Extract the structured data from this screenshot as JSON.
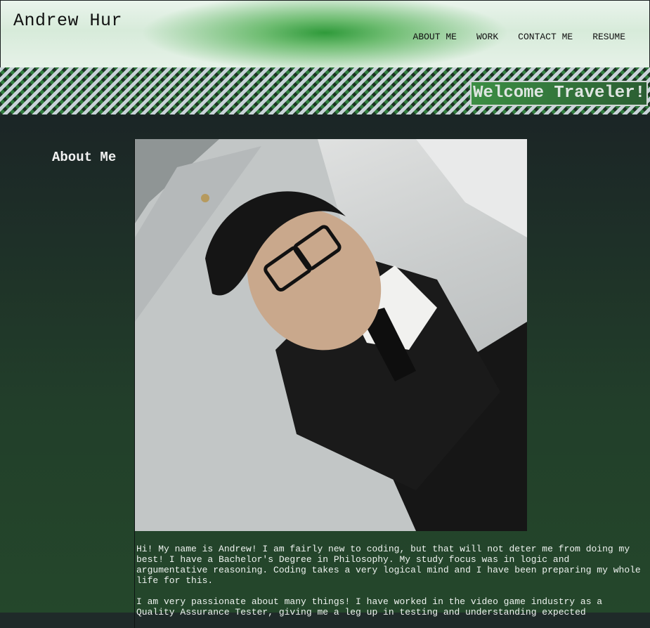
{
  "header": {
    "title": "Andrew Hur",
    "nav": [
      {
        "label": "ABOUT ME"
      },
      {
        "label": "WORK"
      },
      {
        "label": "CONTACT ME"
      },
      {
        "label": "RESUME"
      }
    ]
  },
  "banner": {
    "welcome_text": "Welcome Traveler!"
  },
  "about": {
    "heading": "About Me",
    "photo_icon": "profile-photo",
    "paragraphs": [
      "Hi! My name is Andrew! I am fairly new to coding, but that will not deter me from doing my best! I have a Bachelor's Degree in Philosophy. My study focus was in logic and argumentative reasoning. Coding takes a very logical mind and I have been preparing my whole life for this.",
      "I am very passionate about many things! I have worked in the video game industry as a Quality Assurance Tester, giving me a leg up in testing and understanding expected"
    ]
  },
  "colors": {
    "accent_green": "#2f9a3a",
    "background_dark": "#1f2a29",
    "text_light": "#eef2ef"
  }
}
